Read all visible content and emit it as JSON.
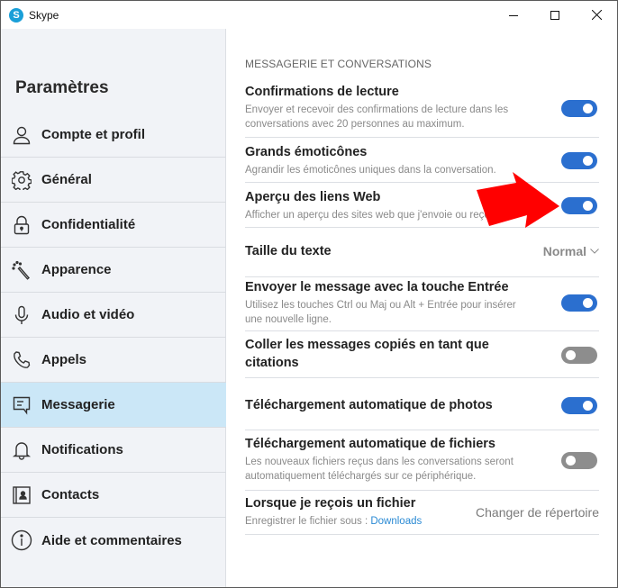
{
  "window": {
    "app_title": "Skype",
    "logo_letter": "S",
    "controls": {
      "minimize": "minimize-icon",
      "maximize": "maximize-icon",
      "close": "close-icon"
    }
  },
  "sidebar": {
    "title": "Paramètres",
    "items": [
      {
        "label": "Compte et profil",
        "icon": "person-icon",
        "active": false
      },
      {
        "label": "Général",
        "icon": "gear-icon",
        "active": false
      },
      {
        "label": "Confidentialité",
        "icon": "lock-icon",
        "active": false
      },
      {
        "label": "Apparence",
        "icon": "magic-wand-icon",
        "active": false
      },
      {
        "label": "Audio et vidéo",
        "icon": "microphone-icon",
        "active": false
      },
      {
        "label": "Appels",
        "icon": "phone-icon",
        "active": false
      },
      {
        "label": "Messagerie",
        "icon": "message-icon",
        "active": true
      },
      {
        "label": "Notifications",
        "icon": "bell-icon",
        "active": false
      },
      {
        "label": "Contacts",
        "icon": "contact-card-icon",
        "active": false
      },
      {
        "label": "Aide et commentaires",
        "icon": "info-icon",
        "active": false
      }
    ]
  },
  "content": {
    "section_title": "MESSAGERIE ET CONVERSATIONS",
    "settings": {
      "read_receipts": {
        "title": "Confirmations de lecture",
        "desc": "Envoyer et recevoir des confirmations de lecture dans les conversations avec 20 personnes au maximum.",
        "enabled": true
      },
      "large_emoticons": {
        "title": "Grands émoticônes",
        "desc": "Agrandir les émoticônes uniques dans la conversation.",
        "enabled": true
      },
      "web_link_preview": {
        "title": "Aperçu des liens Web",
        "desc": "Afficher un aperçu des sites web que j'envoie ou reçois.",
        "enabled": true
      },
      "text_size": {
        "title": "Taille du texte",
        "value": "Normal"
      },
      "enter_to_send": {
        "title": "Envoyer le message avec la touche Entrée",
        "desc": "Utilisez les touches Ctrl ou Maj ou Alt + Entrée pour insérer une nouvelle ligne.",
        "enabled": true
      },
      "paste_as_quote": {
        "title": "Coller les messages copiés en tant que citations",
        "enabled": false
      },
      "auto_download_photos": {
        "title": "Téléchargement automatique de photos",
        "enabled": true
      },
      "auto_download_files": {
        "title": "Téléchargement automatique de fichiers",
        "desc": "Les nouveaux fichiers reçus dans les conversations seront automatiquement téléchargés sur ce périphérique.",
        "enabled": false
      },
      "file_received": {
        "title": "Lorsque je reçois un fichier",
        "desc_prefix": "Enregistrer le fichier sous : ",
        "folder": "Downloads",
        "action": "Changer de répertoire"
      }
    }
  },
  "annotation": {
    "type": "red-arrow",
    "color": "#ff0000",
    "points_to": "web_link_preview toggle"
  },
  "colors": {
    "toggle_on": "#2b6fcf",
    "toggle_off": "#8d8d8d",
    "active_nav": "#cbe7f7",
    "sidebar_bg": "#f1f3f7",
    "link": "#2a8ad4"
  }
}
